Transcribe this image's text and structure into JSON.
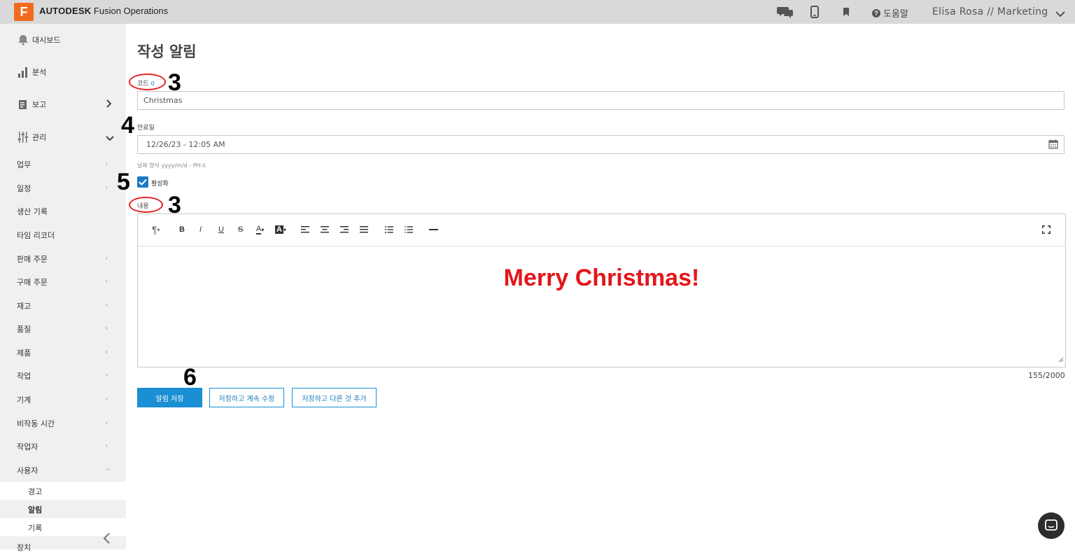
{
  "app": {
    "logo_letter": "F",
    "brand_bold": "AUTODESK",
    "brand_rest": " Fusion Operations",
    "help_label": "도움말",
    "user": "Elisa Rosa // Marketing"
  },
  "sidebar": {
    "main_items": [
      {
        "label": "대시보드",
        "icon": "bell-icon"
      },
      {
        "label": "분석",
        "icon": "bar-chart-icon"
      },
      {
        "label": "보고",
        "icon": "report-icon"
      },
      {
        "label": "관리",
        "icon": "sliders-icon"
      }
    ],
    "sub_items": [
      "업무",
      "일정",
      "생산 기록",
      "타임 리코더",
      "판매 주문",
      "구매 주문",
      "재고",
      "품질",
      "제품",
      "작업",
      "기계",
      "비작동 시간",
      "작업자",
      "사용자"
    ],
    "user_children": [
      "경고",
      "알림",
      "기록"
    ],
    "cut_item": "장치"
  },
  "form": {
    "title": "작성 알림",
    "code_label": "코드",
    "code_required": "0",
    "code_value": "Christmas",
    "expiry_label": "만료일",
    "expiry_value": "12/26/23 - 12:05 AM",
    "date_hint": "날짜 양식 yyyy/m/d - PH:ii.",
    "active_label": "활성화",
    "content_label": "내용",
    "content_text": "Merry Christmas!",
    "char_count": "155/2000"
  },
  "toolbar": {
    "paragraph": "¶",
    "bold": "B",
    "italic": "I",
    "underline": "U",
    "strike": "S",
    "font_color": "A",
    "bg_color": "A"
  },
  "buttons": {
    "save": "알림 저장",
    "save_continue": "저장하고 계속 수정",
    "save_add": "저장하고 다른 것 추가"
  },
  "annotations": [
    "3",
    "4",
    "5",
    "3",
    "6"
  ],
  "colors": {
    "accent": "#1a8fd3",
    "content_text": "#e3161b",
    "annotation_ring": "#e52222",
    "logo": "#f26b1d"
  }
}
